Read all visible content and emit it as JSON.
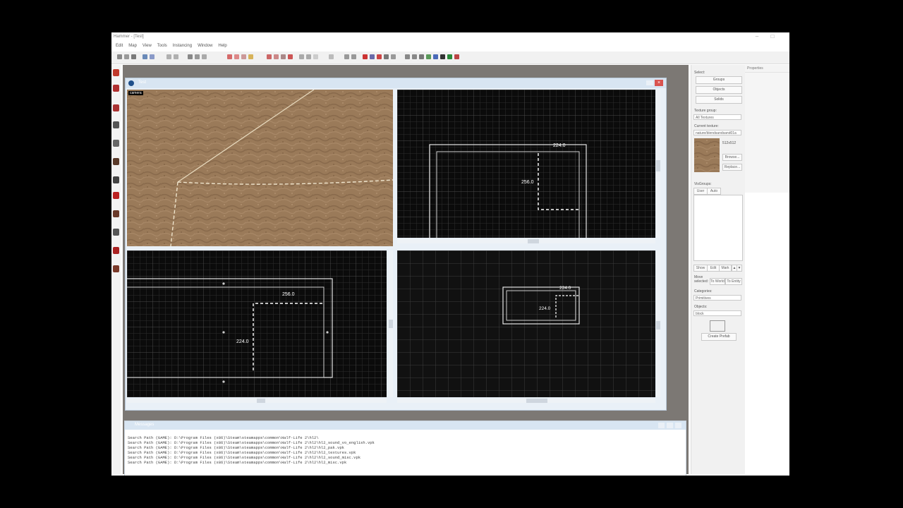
{
  "app": {
    "title": "Hammer - [Test]",
    "menu": [
      "Edit",
      "Map",
      "View",
      "Tools",
      "Instancing",
      "Window",
      "Help"
    ]
  },
  "map_window": {
    "title": "Test",
    "viewports": {
      "camera_label": "camera",
      "top_dim_width": "224.0",
      "top_dim_height": "256.0",
      "front_dim_width": "256.0",
      "front_dim_height": "224.0",
      "side_dim_width": "224.0",
      "side_dim_height": "224.0"
    }
  },
  "messages": {
    "title": "Messages",
    "lines": [
      "Search Path (GAME): D:\\Program Files (x86)\\Steam\\steamapps\\common\\Half-Life 2\\hl2\\",
      "Search Path (GAME): D:\\Program Files (x86)\\Steam\\steamapps\\common\\Half-Life 2\\hl2\\hl2_sound_vo_english.vpk",
      "Search Path (GAME): D:\\Program Files (x86)\\Steam\\steamapps\\common\\Half-Life 2\\hl2\\hl2_pak.vpk",
      "Search Path (GAME): D:\\Program Files (x86)\\Steam\\steamapps\\common\\Half-Life 2\\hl2\\hl2_textures.vpk",
      "Search Path (GAME): D:\\Program Files (x86)\\Steam\\steamapps\\common\\Half-Life 2\\hl2\\hl2_sound_misc.vpk",
      "Search Path (GAME): D:\\Program Files (x86)\\Steam\\steamapps\\common\\Half-Life 2\\hl2\\hl2_misc.vpk"
    ]
  },
  "side_panel": {
    "select_label": "Select:",
    "select_buttons": [
      "Groups",
      "Objects",
      "Solids"
    ],
    "texture_group_label": "Texture group:",
    "texture_group_value": "All Textures",
    "current_texture_label": "Current texture:",
    "current_texture_value": "nature/blendsandsand01a",
    "texture_size": "512x512",
    "browse_label": "Browse...",
    "replace_label": "Replace...",
    "visgroups_label": "VisGroups:",
    "visgroup_tabs": [
      "User",
      "Auto"
    ],
    "visgroup_buttons": [
      "Show",
      "Edit",
      "Mark"
    ],
    "move_selected_label": "Move selected:",
    "move_buttons": [
      "To World",
      "To Entity"
    ],
    "categories_label": "Categories:",
    "categories_value": "Primitives",
    "objects_label": "Objects:",
    "objects_value": "block",
    "create_prefab_label": "Create Prefab"
  },
  "right_panel": {
    "title": "Properties"
  },
  "colors": {
    "viewport_bg": "#0b0b0b",
    "grid_line": "#3a3a3a",
    "brush_outline": "#e6e6e6",
    "texture_sand": "#9b7b5b",
    "workspace_bg": "#7c7874",
    "window_title_bg": "#d8e5f2"
  }
}
